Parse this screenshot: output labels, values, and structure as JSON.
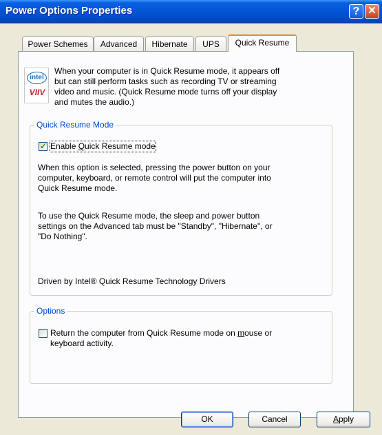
{
  "window": {
    "title": "Power Options Properties"
  },
  "titlebar_buttons": {
    "help": "?",
    "close": "✕"
  },
  "tabs": [
    {
      "label": "Power Schemes"
    },
    {
      "label": "Advanced"
    },
    {
      "label": "Hibernate"
    },
    {
      "label": "UPS"
    },
    {
      "label": "Quick Resume",
      "selected": true
    }
  ],
  "logo": {
    "top": "intel",
    "bottom": "VIIV"
  },
  "intro": {
    "lines": [
      "When your computer is in Quick Resume mode, it appears off",
      "but can still perform tasks such as recording TV or streaming",
      "video and music. (Quick Resume mode turns off your display",
      "and mutes the audio.)"
    ]
  },
  "quick_resume_group": {
    "label": "Quick Resume Mode",
    "checkbox": {
      "label_prefix": "Enable ",
      "label_underline": "Q",
      "label_suffix": "uick Resume mode",
      "checked": true
    },
    "description1": [
      "When this option is selected, pressing the power button on your",
      "computer, keyboard, or remote control will put the computer into",
      "Quick Resume mode."
    ],
    "description2": [
      "To use the Quick Resume mode, the sleep and power button",
      "settings on the Advanced tab must be \"Standby\", \"Hibernate\", or",
      "\"Do Nothing\"."
    ],
    "driver_note": "Driven by Intel® Quick Resume Technology Drivers"
  },
  "options_group": {
    "label": "Options",
    "checkbox": {
      "line1_prefix": "Return the computer from Quick Resume mode on ",
      "line1_underline": "m",
      "line1_suffix": "ouse or",
      "line2": "keyboard activity.",
      "checked": false
    }
  },
  "buttons": {
    "ok": "OK",
    "cancel": "Cancel",
    "apply_underline": "A",
    "apply_rest": "pply"
  }
}
